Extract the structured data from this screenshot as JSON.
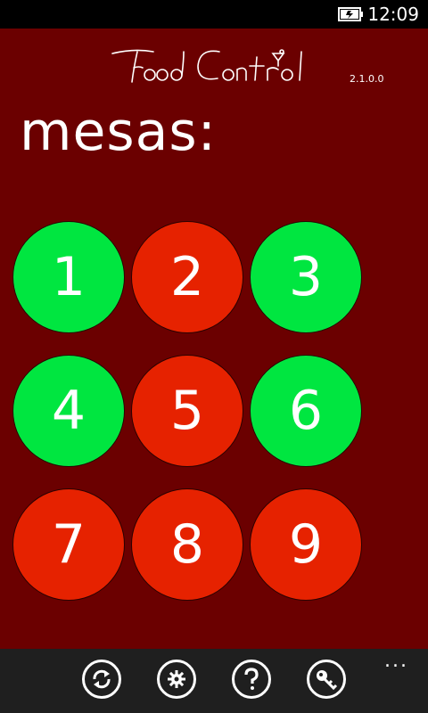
{
  "status_bar": {
    "time": "12:09",
    "icons": [
      "battery-charging-icon"
    ]
  },
  "header": {
    "logo_text": "FoodControl",
    "version": "2.1.0.0"
  },
  "page_title": "mesas:",
  "colors": {
    "background": "#6b0000",
    "free": "#00e640",
    "occupied": "#e62200",
    "app_bar": "#1f1f1f"
  },
  "tables": [
    {
      "number": "1",
      "status": "free"
    },
    {
      "number": "2",
      "status": "occupied"
    },
    {
      "number": "3",
      "status": "free"
    },
    {
      "number": "4",
      "status": "free"
    },
    {
      "number": "5",
      "status": "occupied"
    },
    {
      "number": "6",
      "status": "free"
    },
    {
      "number": "7",
      "status": "occupied"
    },
    {
      "number": "8",
      "status": "occupied"
    },
    {
      "number": "9",
      "status": "occupied"
    }
  ],
  "app_bar": {
    "buttons": [
      "refresh-icon",
      "settings-icon",
      "help-icon",
      "key-icon"
    ],
    "more": "..."
  }
}
